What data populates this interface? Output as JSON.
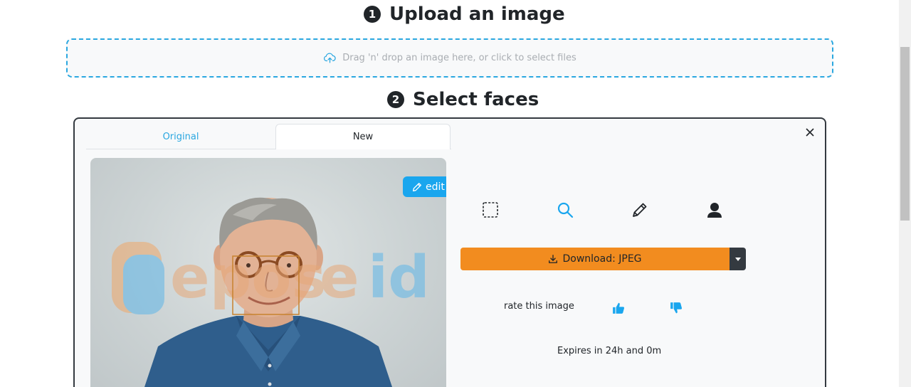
{
  "steps": [
    {
      "number": "1",
      "title": "Upload an image"
    },
    {
      "number": "2",
      "title": "Select faces"
    }
  ],
  "dropzone": {
    "text": "Drag 'n' drop an image here, or click to select files"
  },
  "tabs": [
    {
      "label": "Original",
      "active": false
    },
    {
      "label": "New",
      "active": true
    }
  ],
  "photo": {
    "edit_label": "edit",
    "watermark": "Depositphotos"
  },
  "tools": [
    "select-region-icon",
    "search-icon",
    "pencil-icon",
    "person-icon"
  ],
  "download": {
    "label": "Download: JPEG"
  },
  "rating": {
    "label": "rate this image"
  },
  "expires": {
    "text": "Expires in 24h and 0m"
  },
  "colors": {
    "accent": "#1aa6ee",
    "download": "#f28c1f",
    "dark": "#343a40"
  }
}
